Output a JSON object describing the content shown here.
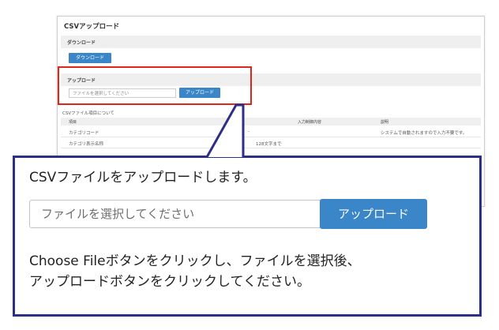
{
  "background": {
    "page_title": "CSVアップロード",
    "download_section": "ダウンロード",
    "download_button": "ダウンロード",
    "upload_section": "アップロード",
    "file_placeholder": "ファイルを選択してください",
    "upload_button": "アップロード",
    "table_caption": "CSVファイル項目について",
    "columns": [
      "項目",
      "入力制御内容",
      "説明"
    ],
    "rows": [
      [
        "カテゴリコード",
        "-",
        "システムで自動されますので入力不要です。"
      ],
      [
        "カテゴリ表示名称",
        "128文字まで",
        ""
      ]
    ]
  },
  "callout": {
    "headline": "CSVファイルをアップロードします。",
    "file_placeholder": "ファイルを選択してください",
    "upload_button": "アップロード",
    "instruction_line1": "Choose Fileボタンをクリックし、ファイルを選択後、",
    "instruction_line2": "アップロードボタンをクリックしてください。"
  },
  "colors": {
    "button_blue": "#3a86c8",
    "highlight_red": "#e0261b",
    "callout_border": "#2d2f87"
  }
}
